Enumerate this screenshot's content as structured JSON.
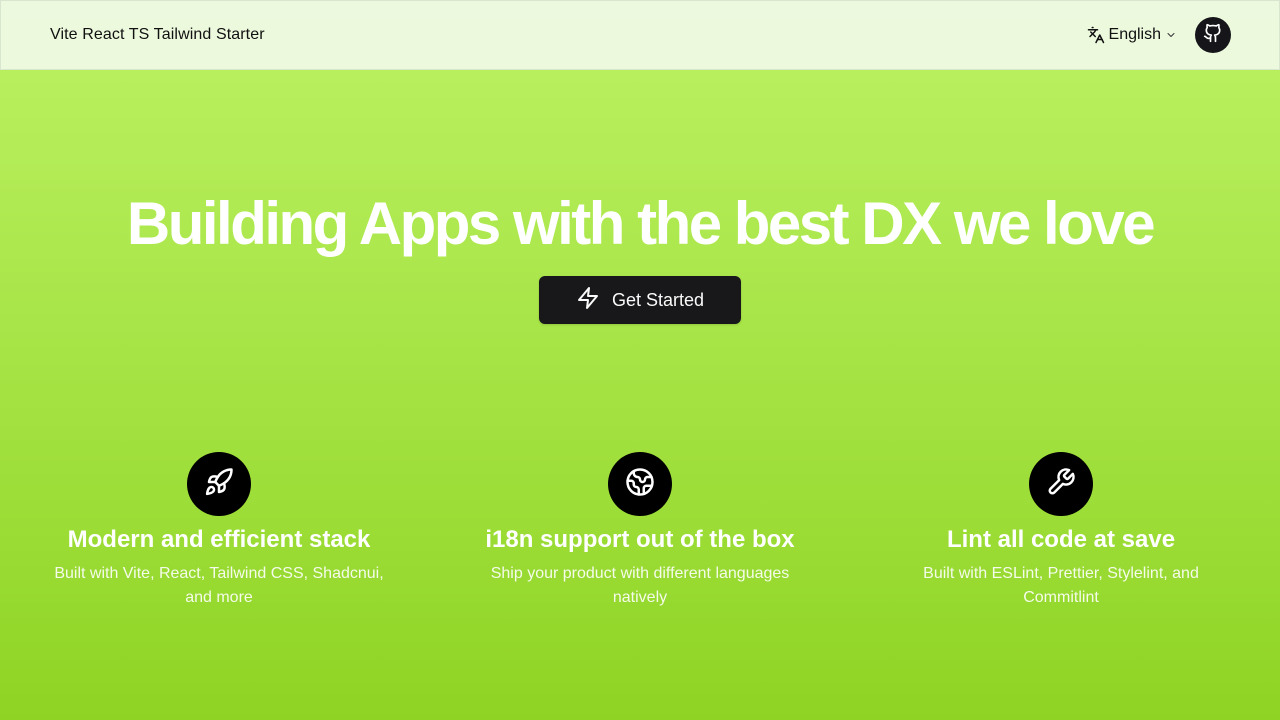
{
  "navbar": {
    "brand": "Vite React TS Tailwind Starter",
    "language": {
      "icon": "translate-icon",
      "label": "English",
      "chevron": "chevron-down-icon"
    },
    "github": {
      "icon": "github-icon"
    }
  },
  "hero": {
    "title": "Building Apps with the best DX we love",
    "cta": {
      "label": "Get Started",
      "icon": "zap-icon"
    }
  },
  "features": [
    {
      "icon": "rocket-icon",
      "title": "Modern and efficient stack",
      "description": "Built with Vite, React, Tailwind CSS, Shadcnui, and more"
    },
    {
      "icon": "globe-icon",
      "title": "i18n support out of the box",
      "description": "Ship your product with different languages natively"
    },
    {
      "icon": "wrench-icon",
      "title": "Lint all code at save",
      "description": "Built with ESLint, Prettier, Stylelint, and Commitlint"
    }
  ],
  "colors": {
    "gradient_top": "#bdf263",
    "gradient_bottom": "#8fd424",
    "button_bg": "#18181b",
    "icon_circle_bg": "#000000"
  }
}
